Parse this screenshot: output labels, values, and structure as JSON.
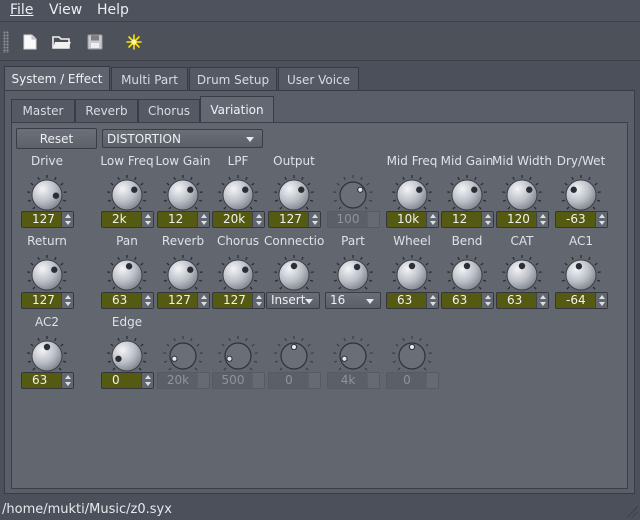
{
  "menu": {
    "file": "File",
    "view": "View",
    "help": "Help"
  },
  "toolbar": {
    "new_icon": "new-document-icon",
    "open_icon": "open-folder-icon",
    "save_icon": "save-icon",
    "burst_icon": "starburst-icon"
  },
  "tabs": [
    "System / Effect",
    "Multi Part",
    "Drum Setup",
    "User Voice"
  ],
  "subtabs": [
    "Master",
    "Reverb",
    "Chorus",
    "Variation"
  ],
  "effect": {
    "reset_label": "Reset",
    "type": "DISTORTION"
  },
  "rows": [
    [
      {
        "label": "Drive",
        "value": "127",
        "enabled": true,
        "level": 0.85
      },
      {
        "label": "Low Freq",
        "value": "2k",
        "enabled": true,
        "level": 0.7
      },
      {
        "label": "Low Gain",
        "value": "12",
        "enabled": true,
        "level": 0.7
      },
      {
        "label": "LPF",
        "value": "20k",
        "enabled": true,
        "level": 0.7
      },
      {
        "label": "Output",
        "value": "127",
        "enabled": true,
        "level": 0.7
      },
      {
        "label": "",
        "value": "100",
        "enabled": false,
        "level": 0.7
      },
      {
        "label": "Mid Freq",
        "value": "10k",
        "enabled": true,
        "level": 0.7
      },
      {
        "label": "Mid Gain",
        "value": "12",
        "enabled": true,
        "level": 0.7
      },
      {
        "label": "Mid Width",
        "value": "120",
        "enabled": true,
        "level": 0.7
      },
      {
        "label": "Dry/Wet",
        "value": "-63",
        "enabled": true,
        "level": 0.3
      }
    ],
    [
      {
        "label": "Return",
        "value": "127",
        "enabled": true,
        "level": 0.7
      },
      {
        "label": "Pan",
        "value": "63",
        "enabled": true,
        "level": 0.55
      },
      {
        "label": "Reverb",
        "value": "127",
        "enabled": true,
        "level": 0.7
      },
      {
        "label": "Chorus",
        "value": "127",
        "enabled": true,
        "level": 0.7
      },
      {
        "label": "Connection",
        "value": "Insert",
        "enabled": true,
        "combo": true,
        "level": 0.5
      },
      {
        "label": "Part",
        "value": "16",
        "enabled": true,
        "combo": true,
        "level": 0.6
      },
      {
        "label": "Wheel",
        "value": "63",
        "enabled": true,
        "level": 0.5
      },
      {
        "label": "Bend",
        "value": "63",
        "enabled": true,
        "level": 0.5
      },
      {
        "label": "CAT",
        "value": "63",
        "enabled": true,
        "level": 0.5
      },
      {
        "label": "AC1",
        "value": "-64",
        "enabled": true,
        "level": 0.45
      }
    ],
    [
      {
        "label": "AC2",
        "value": "63",
        "enabled": true,
        "level": 0.5
      },
      {
        "label": "Edge",
        "value": "0",
        "enabled": true,
        "level": 0.1
      },
      {
        "label": "",
        "value": "20k",
        "enabled": false,
        "level": 0.1
      },
      {
        "label": "",
        "value": "500",
        "enabled": false,
        "level": 0.1
      },
      {
        "label": "",
        "value": "0",
        "enabled": false,
        "level": 0.5
      },
      {
        "label": "",
        "value": "4k",
        "enabled": false,
        "level": 0.1
      },
      {
        "label": "",
        "value": "0",
        "enabled": false,
        "level": 0.5
      }
    ]
  ],
  "status": {
    "path": "/home/mukti/Music/z0.syx"
  },
  "colors": {
    "value_bg": "#555a12",
    "panel": "#62666f",
    "window": "#4c505b"
  }
}
